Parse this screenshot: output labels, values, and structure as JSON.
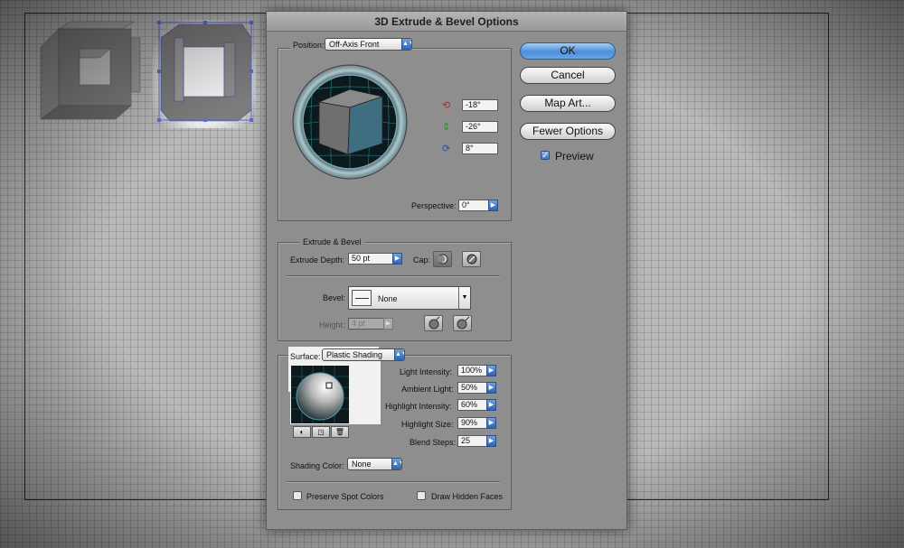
{
  "dialog": {
    "title": "3D Extrude & Bevel Options",
    "buttons": {
      "ok": "OK",
      "cancel": "Cancel",
      "map_art": "Map Art...",
      "fewer_options": "Fewer Options"
    },
    "preview": {
      "label": "Preview",
      "checked": true
    },
    "position": {
      "label": "Position:",
      "value": "Off-Axis Front",
      "rotate_x": "-18°",
      "rotate_y": "-26°",
      "rotate_z": "8°",
      "perspective_label": "Perspective:",
      "perspective_value": "0°"
    },
    "extrude": {
      "legend": "Extrude & Bevel",
      "depth_label": "Extrude Depth:",
      "depth_value": "50 pt",
      "cap_label": "Cap:",
      "bevel_label": "Bevel:",
      "bevel_value": "None",
      "height_label": "Height:",
      "height_value": "4 pt"
    },
    "surface": {
      "label": "Surface:",
      "value": "Plastic Shading",
      "light_intensity_label": "Light Intensity:",
      "light_intensity": "100%",
      "ambient_light_label": "Ambient Light:",
      "ambient_light": "50%",
      "highlight_intensity_label": "Highlight Intensity:",
      "highlight_intensity": "60%",
      "highlight_size_label": "Highlight Size:",
      "highlight_size": "90%",
      "blend_steps_label": "Blend Steps:",
      "blend_steps": "25",
      "shading_color_label": "Shading Color:",
      "shading_color": "None",
      "preserve_spot_colors": "Preserve Spot Colors",
      "draw_hidden_faces": "Draw Hidden Faces"
    }
  },
  "colors": {
    "dialog_bg": "#8e8e8e",
    "cube_front": "#3e6e80",
    "accent_blue": "#3f74c3"
  }
}
